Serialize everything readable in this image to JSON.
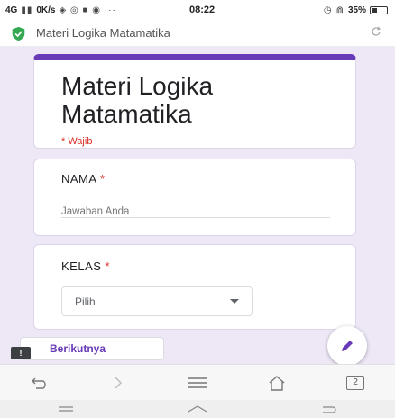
{
  "status_bar": {
    "network": "4G",
    "speed": "0K/s",
    "time": "08:22",
    "battery": "35%"
  },
  "browser": {
    "page_title": "Materi Logika Matamatika"
  },
  "form": {
    "title": "Materi Logika Matamatika",
    "required_note": "* Wajib",
    "questions": [
      {
        "label": "NAMA",
        "required_mark": "*",
        "placeholder": "Jawaban Anda"
      },
      {
        "label": "KELAS",
        "required_mark": "*",
        "select_value": "Pilih"
      }
    ],
    "next_label": "Berikutnya",
    "next_badge": "!"
  },
  "nav": {
    "tab_count": "2"
  },
  "colors": {
    "accent": "#673ab7",
    "page_bg": "#ede7f6",
    "required": "#d93025",
    "shield": "#34a853"
  },
  "icons": [
    "shield-icon",
    "reload-icon",
    "chevron-down-icon",
    "pencil-icon",
    "back-icon",
    "forward-icon",
    "menu-icon",
    "home-icon",
    "tabs-icon"
  ]
}
